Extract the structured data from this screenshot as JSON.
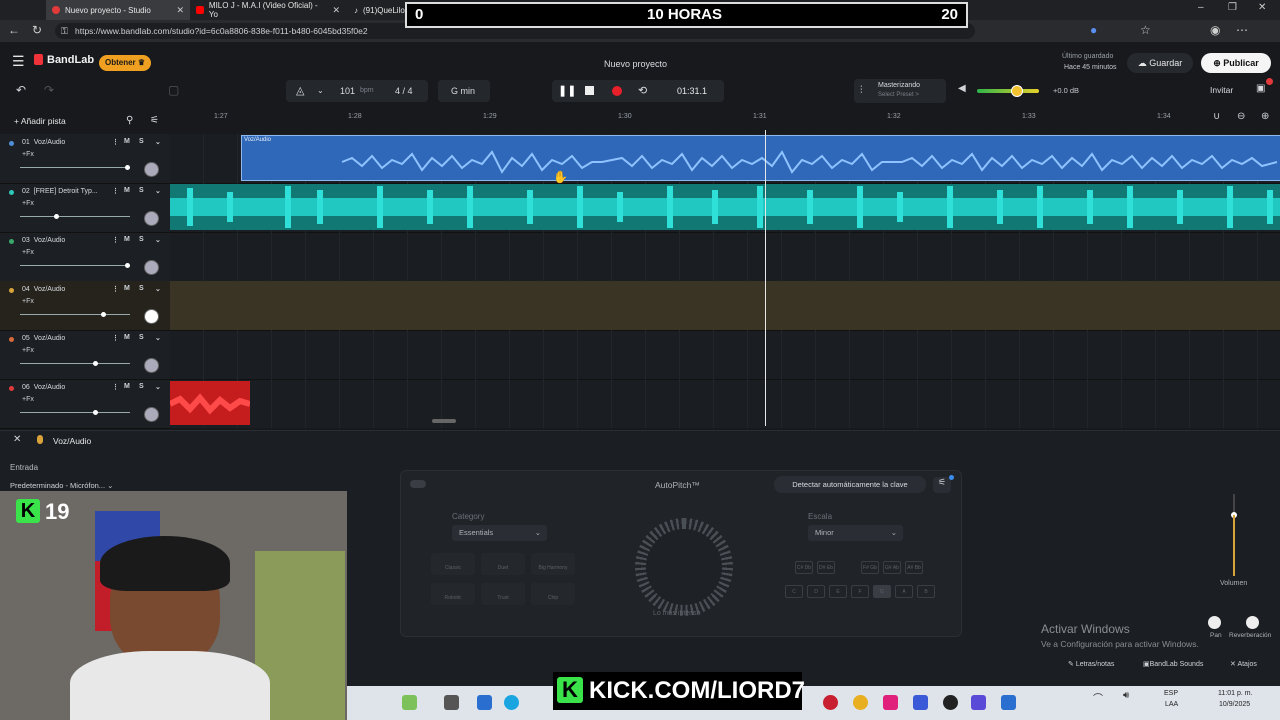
{
  "browser": {
    "tabs": [
      {
        "title": "Nuevo proyecto - Studio",
        "active": true
      },
      {
        "title": "MILO J - M.A.I (Video Oficial) - Yo"
      },
      {
        "title": "(91)QueLiloQue? (@queliloque) | T"
      }
    ],
    "url": "https://www.bandlab.com/studio?id=6c0a8806-838e-f011-b480-6045bd35f0e2"
  },
  "overlay": {
    "left_score": "0",
    "title": "10 HORAS",
    "right_score": "20"
  },
  "app": {
    "brand": "BandLab",
    "get_button": "Obtener",
    "project_title": "Nuevo proyecto",
    "saved_line1": "Último guardado",
    "saved_line2": "Hace 45 minutos",
    "save_button": "Guardar",
    "publish_button": "Publicar",
    "invite_button": "Invitar"
  },
  "transport": {
    "bpm_value": "101",
    "bpm_unit": "bpm",
    "meter": "4 / 4",
    "key": "G min",
    "time": "01:31.1",
    "mastering_title": "Masterizando",
    "mastering_sub": "Select Preset >",
    "gain": "+0.0 dB"
  },
  "add_track": "Añadir pista",
  "ruler": [
    "1:27",
    "1:28",
    "1:29",
    "1:30",
    "1:31",
    "1:32",
    "1:33",
    "1:34"
  ],
  "tracks": [
    {
      "num": "01",
      "name": "Voz/Audio",
      "fx": "+Fx",
      "color": "#4f8fd8",
      "m": "M",
      "s": "S"
    },
    {
      "num": "02",
      "name": "[FREE] Detroit Typ...",
      "fx": "+Fx",
      "color": "#2ec7b8",
      "m": "M",
      "s": "S"
    },
    {
      "num": "03",
      "name": "Voz/Audio",
      "fx": "+Fx",
      "color": "#3aa86a",
      "m": "M",
      "s": "S"
    },
    {
      "num": "04",
      "name": "Voz/Audio",
      "fx": "+Fx",
      "color": "#d8a43a",
      "m": "M",
      "s": "S"
    },
    {
      "num": "05",
      "name": "Voz/Audio",
      "fx": "+Fx",
      "color": "#d86a3a",
      "m": "M",
      "s": "S"
    },
    {
      "num": "06",
      "name": "Voz/Audio",
      "fx": "+Fx",
      "color": "#e23a3a",
      "m": "M",
      "s": "S"
    }
  ],
  "clip_label": "Voz/Audio",
  "panel": {
    "header_title": "Voz/Audio",
    "input_label": "Entrada",
    "input_value": "Predeterminado - Micrófon...",
    "autopitch_title": "AutoPitch™",
    "detect_button": "Detectar automáticamente la clave",
    "category_label": "Category",
    "category_value": "Essentials",
    "scale_label": "Escala",
    "scale_value": "Minor",
    "presets": [
      "Classic",
      "Duet",
      "Big Harmony",
      "Robotic",
      "Trust",
      "Chip"
    ],
    "keys_top": [
      "C#\nDb",
      "D#\nEb",
      "F#\nGb",
      "G#\nAb",
      "A#\nBb"
    ],
    "keys_bottom": [
      "C",
      "D",
      "E",
      "F",
      "G",
      "A",
      "B"
    ],
    "dial_caption": "Lo más intenso",
    "volume_label": "Volumen",
    "pan_label": "Pan",
    "reverb_label": "Reverberación",
    "activate_title": "Activar Windows",
    "activate_sub": "Ve a Configuración para activar Windows.",
    "footer": [
      "Letras/notas",
      "BandLab Sounds",
      "Atajos"
    ]
  },
  "webcam_badge": "19",
  "kick_text": "KICK.COM/LIORD7",
  "taskbar": {
    "lang1": "ESP",
    "lang2": "LAA",
    "time": "11:01 p. m.",
    "date": "10/9/2025"
  }
}
